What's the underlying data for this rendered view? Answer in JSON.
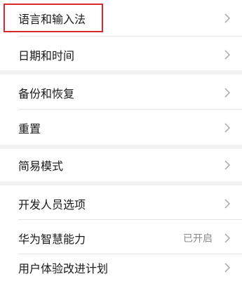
{
  "settings": {
    "groups": [
      {
        "items": [
          {
            "label": "语言和输入法",
            "value": ""
          },
          {
            "label": "日期和时间",
            "value": ""
          }
        ]
      },
      {
        "items": [
          {
            "label": "备份和恢复",
            "value": ""
          },
          {
            "label": "重置",
            "value": ""
          }
        ]
      },
      {
        "items": [
          {
            "label": "简易模式",
            "value": ""
          }
        ]
      },
      {
        "items": [
          {
            "label": "开发人员选项",
            "value": ""
          },
          {
            "label": "华为智慧能力",
            "value": "已开启"
          },
          {
            "label": "用户体验改进计划",
            "value": ""
          }
        ]
      }
    ]
  },
  "icons": {
    "chevron": "chevron-right-icon"
  },
  "colors": {
    "highlight": "#d9272e",
    "background": "#f2f2f2",
    "card": "#ffffff"
  }
}
